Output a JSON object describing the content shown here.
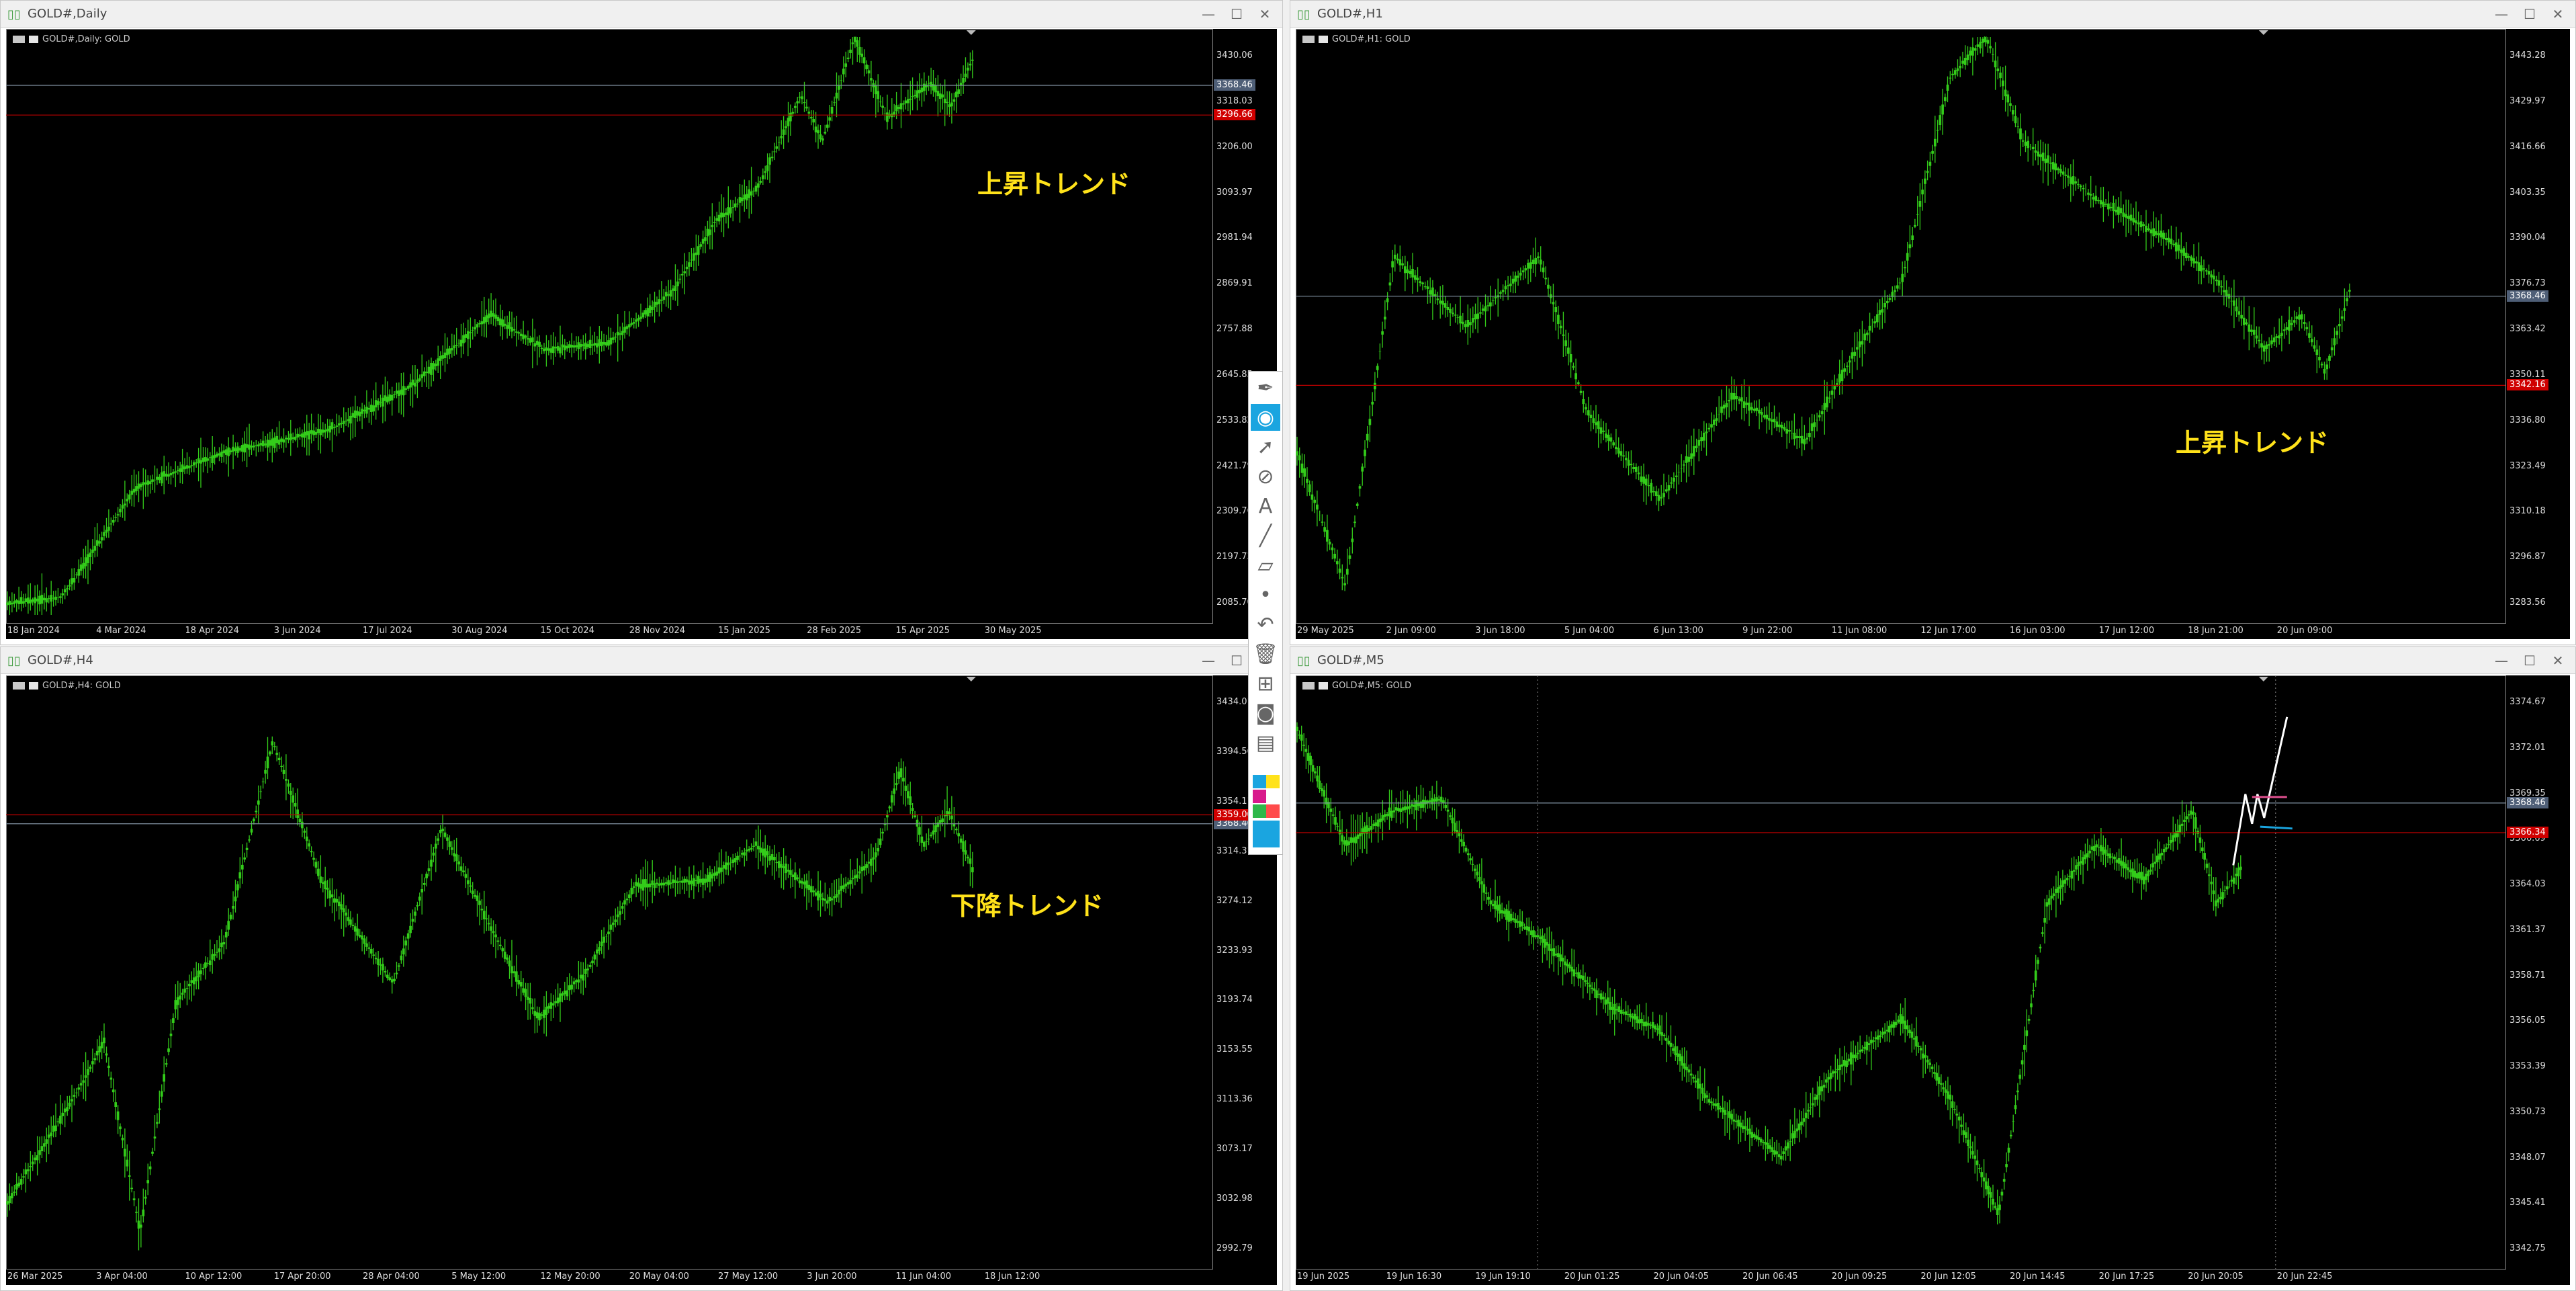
{
  "windows": [
    {
      "title": "GOLD#,Daily",
      "label": "GOLD#,Daily:  GOLD",
      "trend": "上昇トレンド",
      "y_ticks": [
        "3430.06",
        "3318.03",
        "3206.00",
        "3093.97",
        "2981.94",
        "2869.91",
        "2757.88",
        "2645.85",
        "2533.82",
        "2421.79",
        "2309.76",
        "2197.73",
        "2085.70"
      ],
      "price_badges": {
        "bid": "3368.46",
        "line": "3296.66"
      },
      "x_ticks": [
        "18 Jan 2024",
        "4 Mar 2024",
        "18 Apr 2024",
        "3 Jun 2024",
        "17 Jul 2024",
        "30 Aug 2024",
        "15 Oct 2024",
        "28 Nov 2024",
        "15 Jan 2025",
        "28 Feb 2025",
        "15 Apr 2025",
        "30 May 2025"
      ]
    },
    {
      "title": "GOLD#,H1",
      "label": "GOLD#,H1:  GOLD",
      "trend": "上昇トレンド",
      "y_ticks": [
        "3443.28",
        "3429.97",
        "3416.66",
        "3403.35",
        "3390.04",
        "3376.73",
        "3363.42",
        "3350.11",
        "3336.80",
        "3323.49",
        "3310.18",
        "3296.87",
        "3283.56"
      ],
      "price_badges": {
        "bid": "3368.46",
        "line": "3342.16"
      },
      "x_ticks": [
        "29 May 2025",
        "2 Jun 09:00",
        "3 Jun 18:00",
        "5 Jun 04:00",
        "6 Jun 13:00",
        "9 Jun 22:00",
        "11 Jun 08:00",
        "12 Jun 17:00",
        "16 Jun 03:00",
        "17 Jun 12:00",
        "18 Jun 21:00",
        "20 Jun 09:00"
      ]
    },
    {
      "title": "GOLD#,H4",
      "label": "GOLD#,H4:  GOLD",
      "trend": "下降トレンド",
      "y_ticks": [
        "3434.01",
        "3394.56",
        "3354.11",
        "3314.31",
        "3274.12",
        "3233.93",
        "3193.74",
        "3153.55",
        "3113.36",
        "3073.17",
        "3032.98",
        "2992.79"
      ],
      "price_badges": {
        "bid": "3368.46",
        "line": "3359.00"
      },
      "x_ticks": [
        "26 Mar 2025",
        "3 Apr 04:00",
        "10 Apr 12:00",
        "17 Apr 20:00",
        "28 Apr 04:00",
        "5 May 12:00",
        "12 May 20:00",
        "20 May 04:00",
        "27 May 12:00",
        "3 Jun 20:00",
        "11 Jun 04:00",
        "18 Jun 12:00"
      ]
    },
    {
      "title": "GOLD#,M5",
      "label": "GOLD#,M5:  GOLD",
      "trend": "",
      "y_ticks": [
        "3374.67",
        "3372.01",
        "3369.35",
        "3366.69",
        "3364.03",
        "3361.37",
        "3358.71",
        "3356.05",
        "3353.39",
        "3350.73",
        "3348.07",
        "3345.41",
        "3342.75"
      ],
      "price_badges": {
        "bid": "3368.46",
        "line": "3366.34"
      },
      "x_ticks": [
        "19 Jun 2025",
        "19 Jun 16:30",
        "19 Jun 19:10",
        "20 Jun 01:25",
        "20 Jun 04:05",
        "20 Jun 06:45",
        "20 Jun 09:25",
        "20 Jun 12:05",
        "20 Jun 14:45",
        "20 Jun 17:25",
        "20 Jun 20:05",
        "20 Jun 22:45"
      ]
    }
  ],
  "window_buttons": {
    "minimize": "—",
    "maximize": "☐",
    "close": "✕"
  },
  "colors": {
    "candles": "#33cc1a",
    "bid_line": "#7f8f9f",
    "hline": "#c00000",
    "trend_text": "#ffe21a",
    "accent": "#1aa5e0"
  },
  "toolbar": {
    "icons": [
      "pen-icon",
      "eye-icon",
      "arrow-select-icon",
      "eraser-icon",
      "text-icon",
      "line-icon",
      "ruler-icon",
      "dot-icon",
      "undo-icon",
      "trash-icon",
      "stamp-icon",
      "camera-icon",
      "clipboard-icon"
    ],
    "swatches": [
      "#1aa5e0",
      "#ffe21a",
      "#d81b8c",
      "#ffffff",
      "#2db84a",
      "#ff4b4b",
      "#1aa5e0"
    ]
  }
}
